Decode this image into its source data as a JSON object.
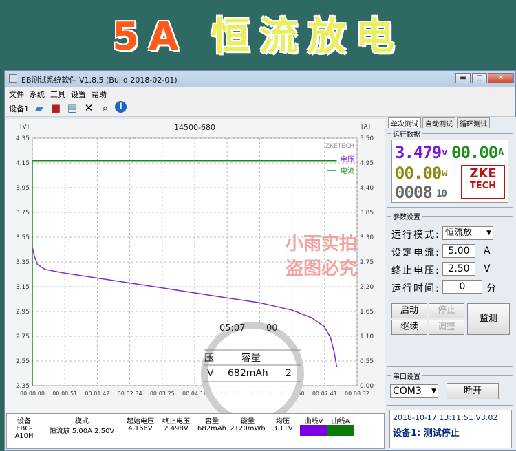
{
  "banner": {
    "title_left": "5A ",
    "title_right": "恒流放电"
  },
  "window": {
    "title": "EB测试系统软件 V1.8.5 (Build 2018-02-01)",
    "min": "▬",
    "max": "□",
    "close": "✕"
  },
  "menu": [
    "文件",
    "系统",
    "工具",
    "设置",
    "帮助"
  ],
  "toolbar": {
    "device": "设备1"
  },
  "chart_data": {
    "type": "line",
    "title": "14500-680",
    "watermark": "ZKETECH",
    "y_left_label": "[V]",
    "y_right_label": "[A]",
    "y_left_ticks": [
      "4.35",
      "4.15",
      "3.95",
      "3.75",
      "3.55",
      "3.35",
      "3.15",
      "2.95",
      "2.75",
      "2.55",
      "2.35"
    ],
    "y_right_ticks": [
      "5.50",
      "4.95",
      "4.40",
      "3.85",
      "3.30",
      "2.75",
      "2.20",
      "1.65",
      "1.10",
      "0.55",
      "0.00"
    ],
    "x_ticks": [
      "00:00:00",
      "00:00:51",
      "00:01:42",
      "00:02:34",
      "00:03:25",
      "00:04:16",
      "00:05:07",
      "00:05:59",
      "00:06:50",
      "00:07:41",
      "00:08:32"
    ],
    "ylim_left": [
      2.35,
      4.35
    ],
    "ylim_right": [
      0,
      5.5
    ],
    "grid": true,
    "series": [
      {
        "name": "电压",
        "color": "#7b2fd0",
        "x_sec": [
          0,
          3,
          8,
          20,
          51,
          102,
          154,
          205,
          256,
          307,
          359,
          410,
          440,
          460,
          470,
          476,
          480
        ],
        "y": [
          3.47,
          3.4,
          3.33,
          3.29,
          3.26,
          3.22,
          3.18,
          3.14,
          3.1,
          3.06,
          3.02,
          2.96,
          2.9,
          2.83,
          2.74,
          2.62,
          2.5
        ]
      },
      {
        "name": "电流",
        "color": "#1e8a1e",
        "x_sec": [
          0,
          480
        ],
        "y_amp": [
          5.0,
          5.0
        ]
      }
    ]
  },
  "overlay": {
    "time": "05:07",
    "time2": "00",
    "header1": "压",
    "header2": "容量",
    "value1": "V",
    "value2": "682mAh",
    "value3": "2"
  },
  "stamp": {
    "line1": "小雨实拍",
    "line2": "盗图必究"
  },
  "tabs": [
    "单次测试",
    "自动测试",
    "循环测试"
  ],
  "run_data": {
    "label": "运行数据",
    "voltage": "3.479",
    "v_unit": "v",
    "current": "00.00",
    "a_unit": "A",
    "power": "00.00",
    "w_unit": "w",
    "time": "0008",
    "time_small": "10",
    "logo1": "ZKE",
    "logo2": "TECH"
  },
  "params": {
    "label": "参数设置",
    "mode_label": "运行模式:",
    "mode": "恒流放",
    "cur_label": "设定电流:",
    "cur": "5.00",
    "cur_unit": "A",
    "volt_label": "终止电压:",
    "volt": "2.50",
    "volt_unit": "V",
    "time_label": "运行时间:",
    "time": "0",
    "time_unit": "分"
  },
  "buttons": {
    "start": "启动",
    "stop": "停止",
    "continue": "继续",
    "adjust": "调整",
    "monitor": "监测"
  },
  "serial": {
    "label": "串口设置",
    "port": "COM3",
    "disconnect": "断开"
  },
  "status": {
    "line1": "2018-10-17 13:11:51  V3.02",
    "line2": "设备1: 测试停止"
  },
  "table": {
    "headers": [
      "设备",
      "模式",
      "起始电压",
      "终止电压",
      "容量",
      "能量",
      "均压",
      "曲线V",
      "曲线A"
    ],
    "row": [
      "EBC-A10H",
      "恒流放  5.00A  2.50V",
      "4.166V",
      "2.498V",
      "682mAh",
      "2120mWh",
      "3.11V",
      "",
      ""
    ],
    "v_color": "#7b00e0",
    "a_color": "#0a7a0a"
  }
}
